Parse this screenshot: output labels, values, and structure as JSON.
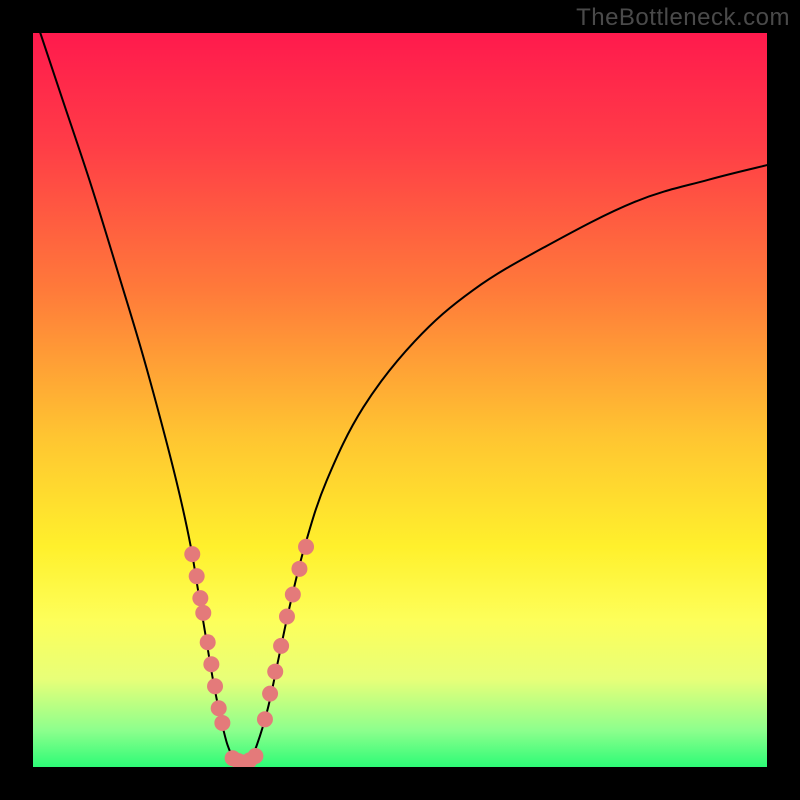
{
  "watermark": "TheBottleneck.com",
  "chart_data": {
    "type": "line",
    "title": "",
    "xlabel": "",
    "ylabel": "",
    "xlim": [
      0,
      100
    ],
    "ylim": [
      0,
      100
    ],
    "grid": false,
    "legend": false,
    "background": {
      "type": "vertical-gradient",
      "stops": [
        {
          "offset": 0,
          "color": "#ff1a4d"
        },
        {
          "offset": 15,
          "color": "#ff3c47"
        },
        {
          "offset": 35,
          "color": "#ff7a3a"
        },
        {
          "offset": 55,
          "color": "#ffc531"
        },
        {
          "offset": 70,
          "color": "#fff02c"
        },
        {
          "offset": 80,
          "color": "#fdff5a"
        },
        {
          "offset": 88,
          "color": "#e8ff78"
        },
        {
          "offset": 95,
          "color": "#8dff8d"
        },
        {
          "offset": 100,
          "color": "#2dfb76"
        }
      ]
    },
    "series": [
      {
        "name": "left-branch",
        "type": "curve",
        "stroke": "#000000",
        "stroke_width": 2,
        "points": [
          {
            "x": 1,
            "y": 100
          },
          {
            "x": 4,
            "y": 91
          },
          {
            "x": 8,
            "y": 79
          },
          {
            "x": 12,
            "y": 66
          },
          {
            "x": 15,
            "y": 56
          },
          {
            "x": 18,
            "y": 45
          },
          {
            "x": 20,
            "y": 37
          },
          {
            "x": 21.5,
            "y": 30
          },
          {
            "x": 22.5,
            "y": 24
          },
          {
            "x": 23.5,
            "y": 18
          },
          {
            "x": 24.5,
            "y": 12
          },
          {
            "x": 25.5,
            "y": 7
          },
          {
            "x": 26.5,
            "y": 3
          },
          {
            "x": 27.5,
            "y": 1
          },
          {
            "x": 28.5,
            "y": 0.5
          }
        ]
      },
      {
        "name": "right-branch",
        "type": "curve",
        "stroke": "#000000",
        "stroke_width": 2,
        "points": [
          {
            "x": 28.5,
            "y": 0.5
          },
          {
            "x": 29.5,
            "y": 1
          },
          {
            "x": 30.5,
            "y": 3
          },
          {
            "x": 32,
            "y": 8
          },
          {
            "x": 33.5,
            "y": 15
          },
          {
            "x": 35,
            "y": 22
          },
          {
            "x": 37,
            "y": 30
          },
          {
            "x": 40,
            "y": 39
          },
          {
            "x": 45,
            "y": 49
          },
          {
            "x": 52,
            "y": 58
          },
          {
            "x": 60,
            "y": 65
          },
          {
            "x": 70,
            "y": 71
          },
          {
            "x": 82,
            "y": 77
          },
          {
            "x": 92,
            "y": 80
          },
          {
            "x": 100,
            "y": 82
          }
        ]
      },
      {
        "name": "dots-left",
        "type": "scatter",
        "color": "#e47a7a",
        "radius": 8,
        "points": [
          {
            "x": 21.7,
            "y": 29
          },
          {
            "x": 22.3,
            "y": 26
          },
          {
            "x": 22.8,
            "y": 23
          },
          {
            "x": 23.2,
            "y": 21
          },
          {
            "x": 23.8,
            "y": 17
          },
          {
            "x": 24.3,
            "y": 14
          },
          {
            "x": 24.8,
            "y": 11
          },
          {
            "x": 25.3,
            "y": 8
          },
          {
            "x": 25.8,
            "y": 6
          }
        ]
      },
      {
        "name": "dots-bottom",
        "type": "scatter",
        "color": "#e47a7a",
        "radius": 8,
        "points": [
          {
            "x": 27.2,
            "y": 1.2
          },
          {
            "x": 28.0,
            "y": 0.8
          },
          {
            "x": 28.7,
            "y": 0.6
          },
          {
            "x": 29.5,
            "y": 0.9
          },
          {
            "x": 30.3,
            "y": 1.5
          }
        ]
      },
      {
        "name": "dots-right",
        "type": "scatter",
        "color": "#e47a7a",
        "radius": 8,
        "points": [
          {
            "x": 31.6,
            "y": 6.5
          },
          {
            "x": 32.3,
            "y": 10
          },
          {
            "x": 33.0,
            "y": 13
          },
          {
            "x": 33.8,
            "y": 16.5
          },
          {
            "x": 34.6,
            "y": 20.5
          },
          {
            "x": 35.4,
            "y": 23.5
          },
          {
            "x": 36.3,
            "y": 27
          },
          {
            "x": 37.2,
            "y": 30
          }
        ]
      }
    ]
  }
}
